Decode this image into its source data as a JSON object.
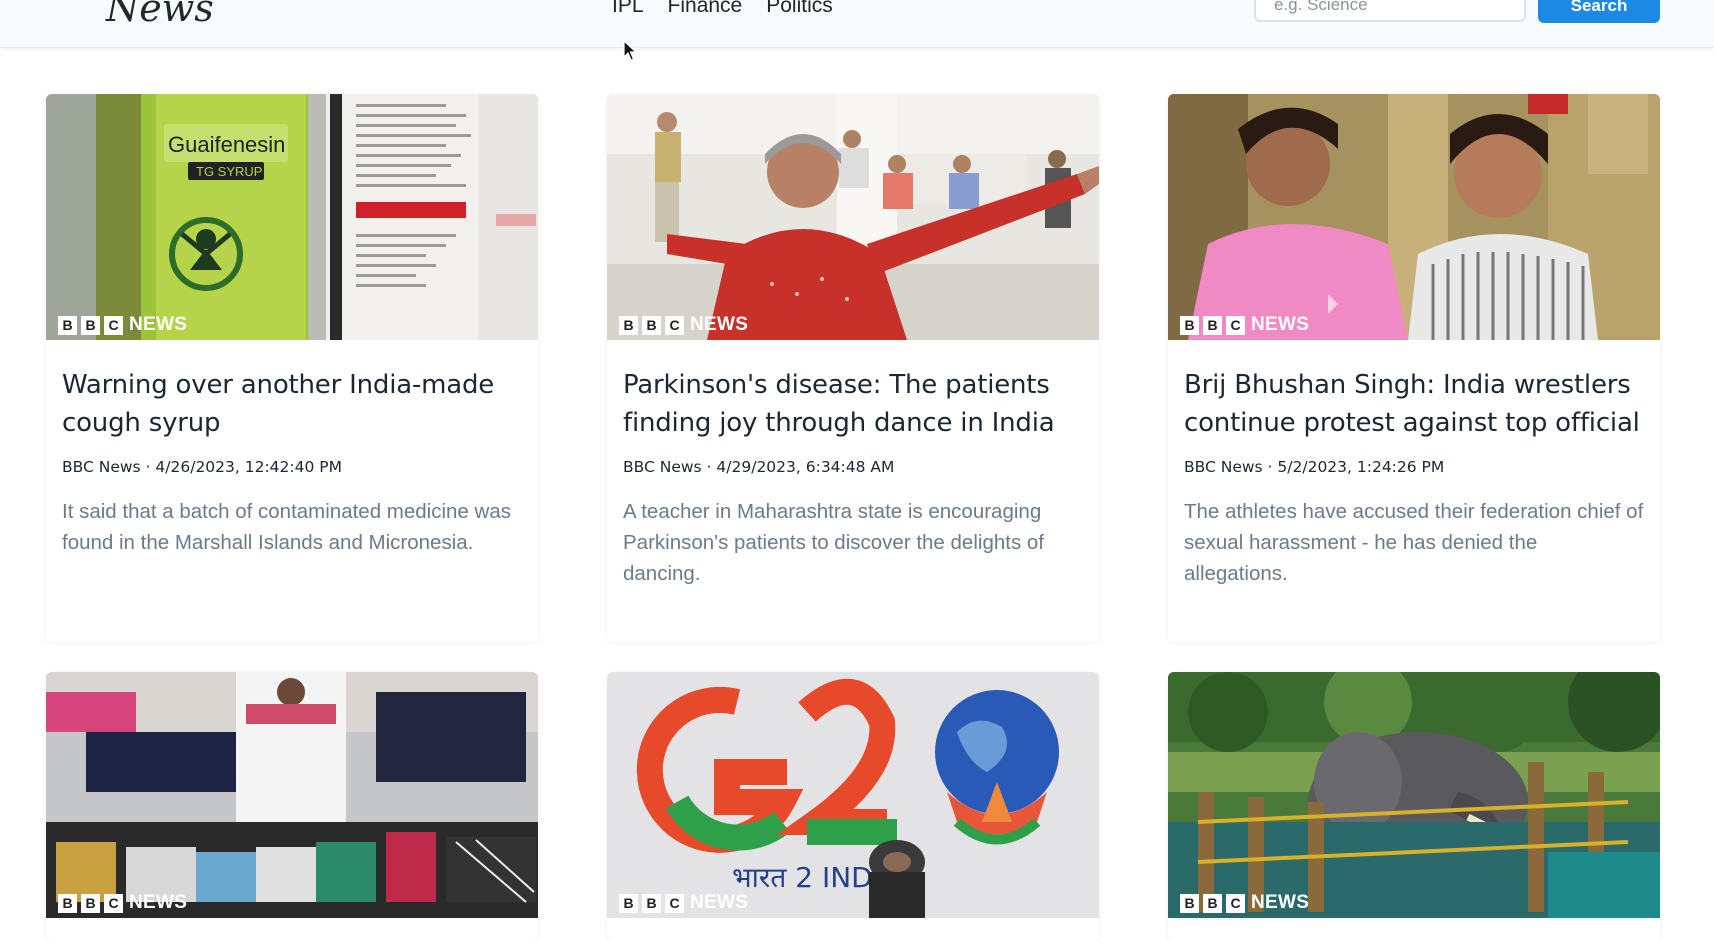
{
  "navbar": {
    "logo_text": "News",
    "links": [
      "IPL",
      "Finance",
      "Politics"
    ],
    "search_placeholder": "e.g. Science",
    "search_button": "Search"
  },
  "brand": {
    "boxes": [
      "B",
      "B",
      "C"
    ],
    "label": "NEWS"
  },
  "articles": [
    {
      "title": "Warning over another India-made cough syrup",
      "meta": "BBC News · 4/26/2023, 12:42:40 PM",
      "description": "It said that a batch of contaminated medicine was found in the Marshall Islands and Micronesia.",
      "image_label": "Guaifenesin",
      "image_sublabel": "TG SYRUP"
    },
    {
      "title": "Parkinson's disease: The patients finding joy through dance in India",
      "meta": "BBC News · 4/29/2023, 6:34:48 AM",
      "description": "A teacher in Maharashtra state is encouraging Parkinson's patients to discover the delights of dancing."
    },
    {
      "title": "Brij Bhushan Singh: India wrestlers continue protest against top official",
      "meta": "BBC News · 5/2/2023, 1:24:26 PM",
      "description": "The athletes have accused their federation chief of sexual harassment - he has denied the allegations."
    },
    {
      "title": "",
      "meta": "",
      "description": ""
    },
    {
      "title": "",
      "meta": "",
      "description": "",
      "image_label": "G2",
      "image_sublabel": "भारत 2  INDIA"
    },
    {
      "title": "",
      "meta": "",
      "description": ""
    }
  ]
}
